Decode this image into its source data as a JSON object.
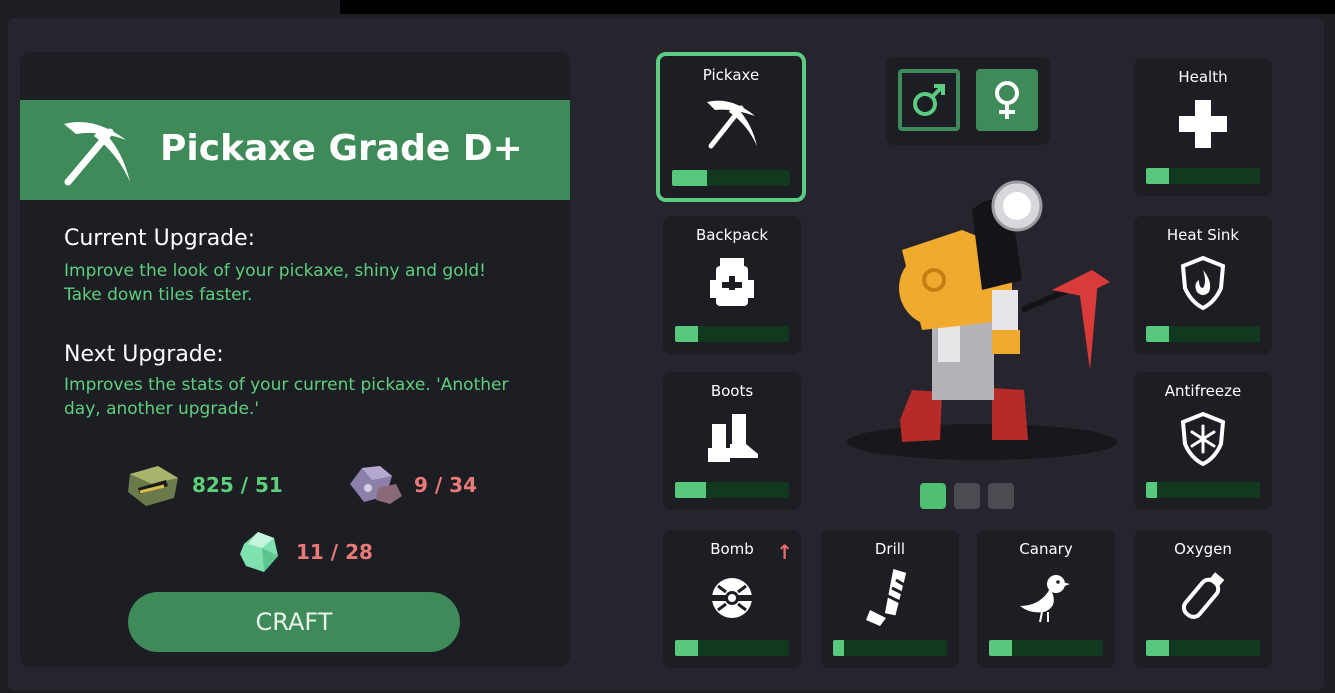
{
  "item": {
    "title": "Pickaxe Grade D+",
    "current_heading": "Current Upgrade:",
    "current_text": "Improve the look of your pickaxe, shiny and gold! Take down tiles faster.",
    "next_heading": "Next Upgrade:",
    "next_text": "Improves the stats of your current pickaxe. 'Another day, another upgrade.'"
  },
  "resources": [
    {
      "icon": "ore-icon",
      "amount": "825 / 51",
      "status": "sufficient",
      "color": "#5dd07c"
    },
    {
      "icon": "rock-icon",
      "amount": "9 / 34",
      "status": "insufficient",
      "color": "#e97a78"
    },
    {
      "icon": "crystal-icon",
      "amount": "11 / 28",
      "status": "insufficient",
      "color": "#e97a78"
    }
  ],
  "craft_label": "CRAFT",
  "upgrades": {
    "pickaxe": {
      "label": "Pickaxe",
      "icon": "pickaxe-icon",
      "progress": 0.3,
      "selected": true
    },
    "backpack": {
      "label": "Backpack",
      "icon": "backpack-icon",
      "progress": 0.2
    },
    "boots": {
      "label": "Boots",
      "icon": "boots-icon",
      "progress": 0.27
    },
    "bomb": {
      "label": "Bomb",
      "icon": "bomb-icon",
      "progress": 0.2,
      "upgrade_available": true
    },
    "drill": {
      "label": "Drill",
      "icon": "drill-icon",
      "progress": 0.1
    },
    "canary": {
      "label": "Canary",
      "icon": "canary-icon",
      "progress": 0.2
    },
    "oxygen": {
      "label": "Oxygen",
      "icon": "oxygen-icon",
      "progress": 0.2
    },
    "health": {
      "label": "Health",
      "icon": "health-icon",
      "progress": 0.2
    },
    "heat_sink": {
      "label": "Heat Sink",
      "icon": "heat-sink-icon",
      "progress": 0.2
    },
    "antifreeze": {
      "label": "Antifreeze",
      "icon": "antifreeze-icon",
      "progress": 0.1
    }
  },
  "gender": {
    "options": [
      "male",
      "female"
    ],
    "selected": "female"
  },
  "pager": {
    "count": 3,
    "active": 1
  },
  "colors": {
    "accent": "#3e8a59",
    "bar_fill": "#58c97c",
    "bar_track": "#0f3a20",
    "text_green": "#5dd07c",
    "text_red": "#e97a78"
  }
}
